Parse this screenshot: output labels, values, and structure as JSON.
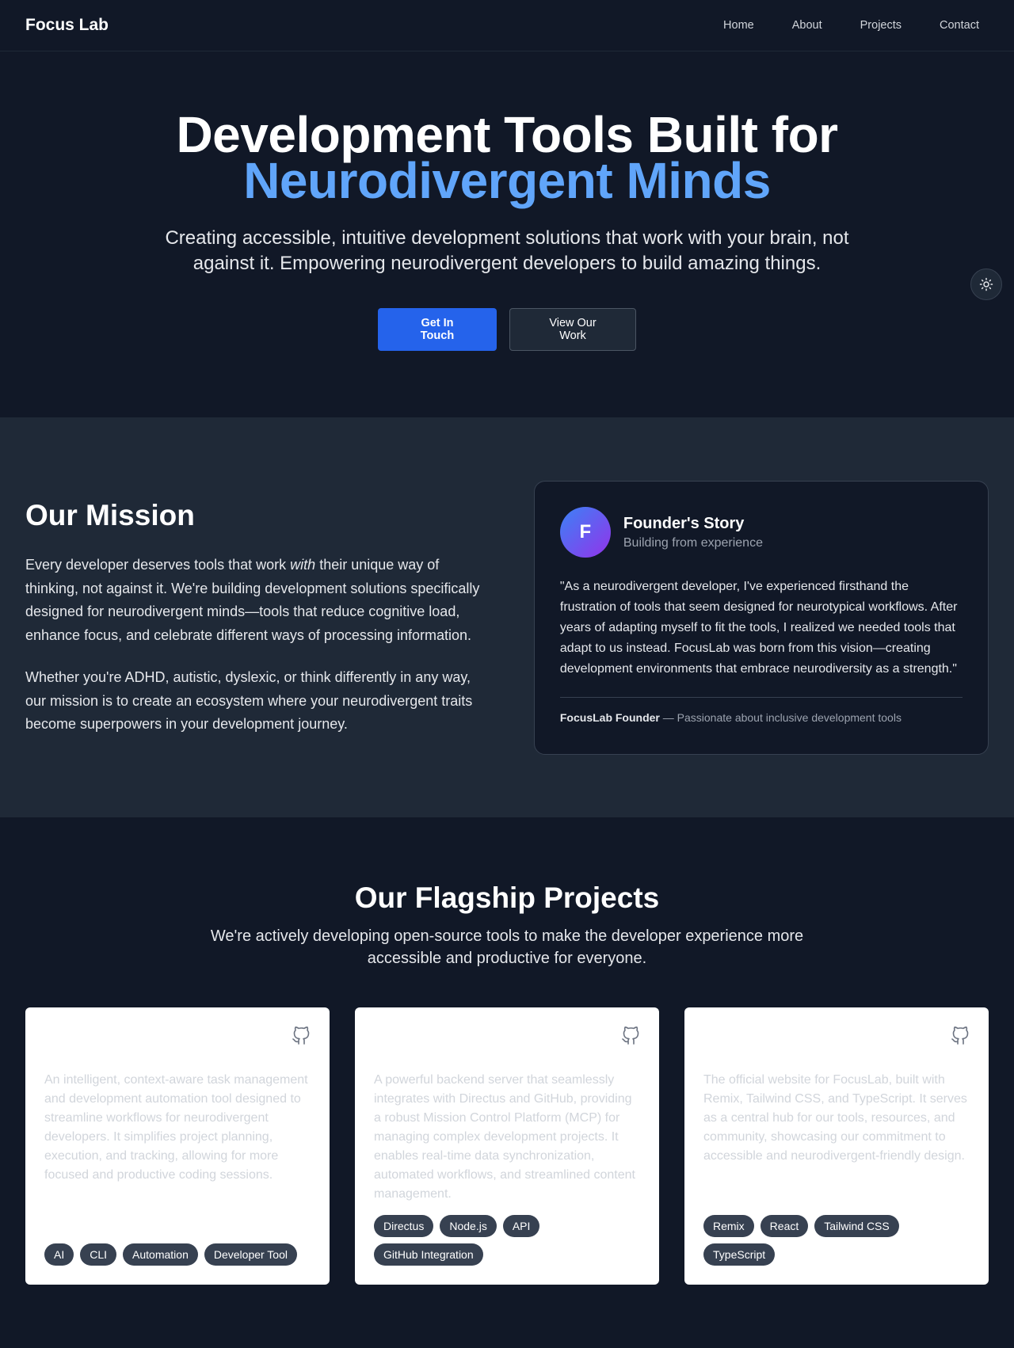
{
  "header": {
    "logo": "Focus Lab",
    "nav": [
      "Home",
      "About",
      "Projects",
      "Contact"
    ]
  },
  "hero": {
    "title_line1": "Development Tools Built for",
    "title_line2": "Neurodivergent Minds",
    "subtitle": "Creating accessible, intuitive development solutions that work with your brain, not against it. Empowering neurodivergent developers to build amazing things.",
    "primary_button": "Get In Touch",
    "secondary_button": "View Our Work",
    "theme_toggle_icon": "sun-icon"
  },
  "mission": {
    "title": "Our Mission",
    "p1_before": "Every developer deserves tools that work ",
    "p1_emphasis": "with",
    "p1_after": " their unique way of thinking, not against it. We're building development solutions specifically designed for neurodivergent minds—tools that reduce cognitive load, enhance focus, and celebrate different ways of processing information.",
    "p2": "Whether you're ADHD, autistic, dyslexic, or think differently in any way, our mission is to create an ecosystem where your neurodivergent traits become superpowers in your development journey.",
    "founder": {
      "avatar_letter": "F",
      "title": "Founder's Story",
      "subtitle": "Building from experience",
      "quote": "\"As a neurodivergent developer, I've experienced firsthand the frustration of tools that seem designed for neurotypical workflows. After years of adapting myself to fit the tools, I realized we needed tools that adapt to us instead. FocusLab was born from this vision—creating development environments that embrace neurodiversity as a strength.\"",
      "name": "FocusLab Founder",
      "role": " — Passionate about inclusive development tools"
    }
  },
  "projects": {
    "title": "Our Flagship Projects",
    "lead": "We're actively developing open-source tools to make the developer experience more accessible and productive for everyone.",
    "cards": [
      {
        "description": "An intelligent, context-aware task management and development automation tool designed to streamline workflows for neurodivergent developers. It simplifies project planning, execution, and tracking, allowing for more focused and productive coding sessions.",
        "tags": [
          "AI",
          "CLI",
          "Automation",
          "Developer Tool"
        ]
      },
      {
        "description": "A powerful backend server that seamlessly integrates with Directus and GitHub, providing a robust Mission Control Platform (MCP) for managing complex development projects. It enables real-time data synchronization, automated workflows, and streamlined content management.",
        "tags": [
          "Directus",
          "Node.js",
          "API",
          "GitHub Integration"
        ]
      },
      {
        "description": "The official website for FocusLab, built with Remix, Tailwind CSS, and TypeScript. It serves as a central hub for our tools, resources, and community, showcasing our commitment to accessible and neurodivergent-friendly design.",
        "tags": [
          "Remix",
          "React",
          "Tailwind CSS",
          "TypeScript"
        ]
      }
    ]
  },
  "colors": {
    "background": "#111827",
    "section_alt": "#1f2937",
    "accent": "#60a5fa",
    "primary_button": "#2563eb"
  }
}
